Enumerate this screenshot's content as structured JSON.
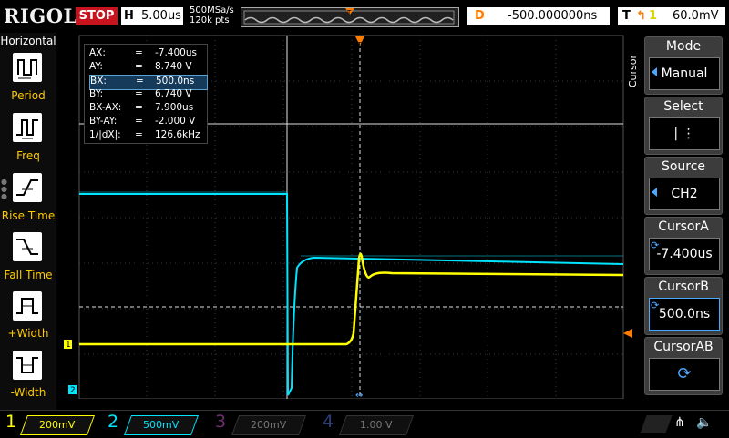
{
  "brand": "RIGOL",
  "status": "STOP",
  "horizontal": {
    "label": "H",
    "timebase": "5.00us"
  },
  "sampling": {
    "rate": "500MSa/s",
    "points": "120k pts"
  },
  "delay": {
    "label": "D",
    "value": "-500.000000ns"
  },
  "trigger": {
    "label": "T",
    "source": "1",
    "level": "60.0mV"
  },
  "left_menu": {
    "title": "Horizontal",
    "items": [
      {
        "label": "Period",
        "icon": "period-icon"
      },
      {
        "label": "Freq",
        "icon": "freq-icon"
      },
      {
        "label": "Rise Time",
        "icon": "rise-time-icon"
      },
      {
        "label": "Fall Time",
        "icon": "fall-time-icon"
      },
      {
        "label": "+Width",
        "icon": "positive-width-icon"
      },
      {
        "label": "-Width",
        "icon": "negative-width-icon"
      }
    ]
  },
  "readout": {
    "rows": [
      {
        "key": "AX:",
        "value": "-7.400us"
      },
      {
        "key": "AY:",
        "value": "8.740 V"
      },
      {
        "key": "BX:",
        "value": "500.0ns"
      },
      {
        "key": "BY:",
        "value": "6.740 V"
      },
      {
        "key": "BX-AX:",
        "value": "7.900us"
      },
      {
        "key": "BY-AY:",
        "value": "-2.000 V"
      },
      {
        "key": "1/|dX|:",
        "value": "126.6kHz"
      }
    ],
    "highlighted_row": 2,
    "equals": "="
  },
  "right_menu": {
    "section": "Cursor",
    "items": [
      {
        "title": "Mode",
        "value": "Manual"
      },
      {
        "title": "Select",
        "value": "|   ⋮"
      },
      {
        "title": "Source",
        "value": "CH2"
      },
      {
        "title": "CursorA",
        "value": "-7.400us"
      },
      {
        "title": "CursorB",
        "value": "500.0ns"
      },
      {
        "title": "CursorAB",
        "value": ""
      }
    ]
  },
  "channels": [
    {
      "number": "1",
      "scale": "200mV",
      "color": "#ffff00",
      "active": true
    },
    {
      "number": "2",
      "scale": "500mV",
      "color": "#00e5ff",
      "active": true
    },
    {
      "number": "3",
      "scale": "200mV",
      "color": "#ff66ff",
      "active": false
    },
    {
      "number": "4",
      "scale": "1.00 V",
      "color": "#3a7bff",
      "active": false
    }
  ],
  "markers": {
    "ch1": "1",
    "ch2": "2",
    "trigger": "T"
  },
  "colors": {
    "ch1": "#ffff00",
    "ch2": "#00e5ff",
    "trigger": "#ff7d00",
    "cursor_highlight": "#5aa0d0"
  }
}
